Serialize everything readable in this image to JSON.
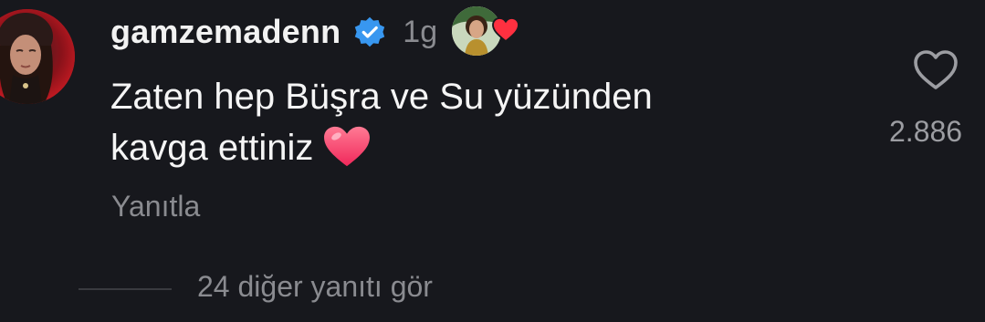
{
  "comment": {
    "username": "gamzemadenn",
    "verified_icon": "verified-badge-icon",
    "time_ago": "1g",
    "text_line1": "Zaten hep Büşra ve Su yüzünden",
    "text_line2": "kavga ettiniz",
    "reply_label": "Yanıtla",
    "like_count": "2.886",
    "more_replies_label": "24 diğer yanıtı gör"
  },
  "colors": {
    "background": "#17181d",
    "verified_blue": "#3897f0",
    "heart_red": "#ff3040",
    "muted_text": "#8a8b90"
  }
}
